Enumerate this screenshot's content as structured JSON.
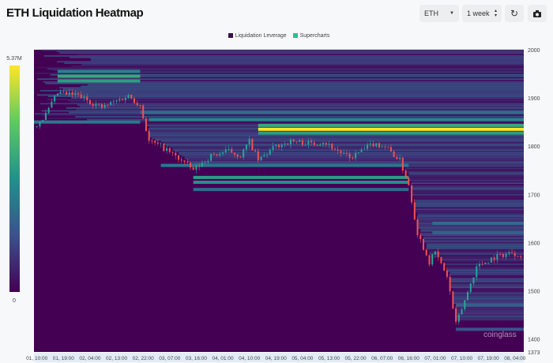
{
  "header": {
    "title": "ETH Liquidation Heatmap",
    "symbol_select": "ETH",
    "range_select": "1 week",
    "refresh_icon": "refresh-icon",
    "camera_icon": "camera-icon"
  },
  "legend": [
    {
      "label": "Liquidation Leverage",
      "color": "#3b0f4f"
    },
    {
      "label": "Supercharts",
      "color": "#22c58b"
    }
  ],
  "colorbar": {
    "max_label": "5.37M",
    "min_label": "0",
    "colormap": "viridis"
  },
  "watermark": "coinglass",
  "chart_data": {
    "type": "heatmap",
    "overlay": "candlestick",
    "ylim": [
      1373,
      2000
    ],
    "y_ticks": [
      2000,
      1900,
      1800,
      1700,
      1600,
      1500,
      1400,
      1373
    ],
    "x_ticks": [
      "01, 10:00",
      "01, 19:00",
      "02, 04:00",
      "02, 13:00",
      "02, 22:00",
      "03, 07:00",
      "03, 16:00",
      "04, 01:00",
      "04, 10:00",
      "04, 19:00",
      "05, 04:00",
      "05, 13:00",
      "05, 22:00",
      "06, 07:00",
      "06, 16:00",
      "07, 01:00",
      "07, 10:00",
      "07, 19:00",
      "08, 04:00"
    ],
    "xlim": [
      "01 09:00",
      "08 07:00"
    ],
    "price_path": [
      [
        "01 09:00",
        1840
      ],
      [
        "01 13:00",
        1865
      ],
      [
        "01 17:00",
        1910
      ],
      [
        "02 00:00",
        1905
      ],
      [
        "02 08:00",
        1880
      ],
      [
        "02 17:00",
        1905
      ],
      [
        "02 21:00",
        1885
      ],
      [
        "03 00:00",
        1810
      ],
      [
        "03 04:00",
        1800
      ],
      [
        "03 11:00",
        1770
      ],
      [
        "03 15:00",
        1750
      ],
      [
        "03 21:00",
        1780
      ],
      [
        "04 03:00",
        1790
      ],
      [
        "04 07:00",
        1780
      ],
      [
        "04 10:00",
        1810
      ],
      [
        "04 13:00",
        1770
      ],
      [
        "04 19:00",
        1800
      ],
      [
        "05 00:00",
        1810
      ],
      [
        "05 08:00",
        1805
      ],
      [
        "05 11:00",
        1810
      ],
      [
        "05 16:00",
        1790
      ],
      [
        "05 20:00",
        1775
      ],
      [
        "06 00:00",
        1790
      ],
      [
        "06 04:00",
        1805
      ],
      [
        "06 08:00",
        1800
      ],
      [
        "06 13:00",
        1770
      ],
      [
        "06 16:00",
        1720
      ],
      [
        "06 19:00",
        1620
      ],
      [
        "06 23:00",
        1560
      ],
      [
        "07 01:00",
        1580
      ],
      [
        "07 05:00",
        1530
      ],
      [
        "07 08:00",
        1430
      ],
      [
        "07 11:00",
        1480
      ],
      [
        "07 15:00",
        1550
      ],
      [
        "07 21:00",
        1570
      ],
      [
        "08 03:00",
        1580
      ],
      [
        "08 05:00",
        1575
      ]
    ],
    "liquidation_bands": [
      {
        "price": 1835,
        "from": "04 13:00",
        "to": "08 07:00",
        "intensity": 1.0
      },
      {
        "price": 1843,
        "from": "04 13:00",
        "to": "08 07:00",
        "intensity": 0.6
      },
      {
        "price": 1827,
        "from": "04 13:00",
        "to": "08 07:00",
        "intensity": 0.55
      },
      {
        "price": 1855,
        "from": "03 00:00",
        "to": "08 07:00",
        "intensity": 0.45
      },
      {
        "price": 1870,
        "from": "02 21:00",
        "to": "08 07:00",
        "intensity": 0.35
      },
      {
        "price": 1945,
        "from": "01 17:00",
        "to": "02 21:00",
        "intensity": 0.6
      },
      {
        "price": 1935,
        "from": "01 17:00",
        "to": "02 21:00",
        "intensity": 0.55
      },
      {
        "price": 1955,
        "from": "01 17:00",
        "to": "02 21:00",
        "intensity": 0.45
      },
      {
        "price": 1850,
        "from": "01 09:00",
        "to": "02 21:00",
        "intensity": 0.4
      },
      {
        "price": 1735,
        "from": "03 15:00",
        "to": "06 16:00",
        "intensity": 0.55
      },
      {
        "price": 1725,
        "from": "03 15:00",
        "to": "06 16:00",
        "intensity": 0.5
      },
      {
        "price": 1710,
        "from": "03 15:00",
        "to": "06 16:00",
        "intensity": 0.35
      },
      {
        "price": 1760,
        "from": "03 04:00",
        "to": "06 16:00",
        "intensity": 0.4
      },
      {
        "price": 1640,
        "from": "07 00:00",
        "to": "08 07:00",
        "intensity": 0.35
      },
      {
        "price": 1620,
        "from": "07 00:00",
        "to": "08 07:00",
        "intensity": 0.3
      },
      {
        "price": 1470,
        "from": "07 08:00",
        "to": "08 07:00",
        "intensity": 0.3
      },
      {
        "price": 1420,
        "from": "07 08:00",
        "to": "08 07:00",
        "intensity": 0.25
      }
    ]
  }
}
